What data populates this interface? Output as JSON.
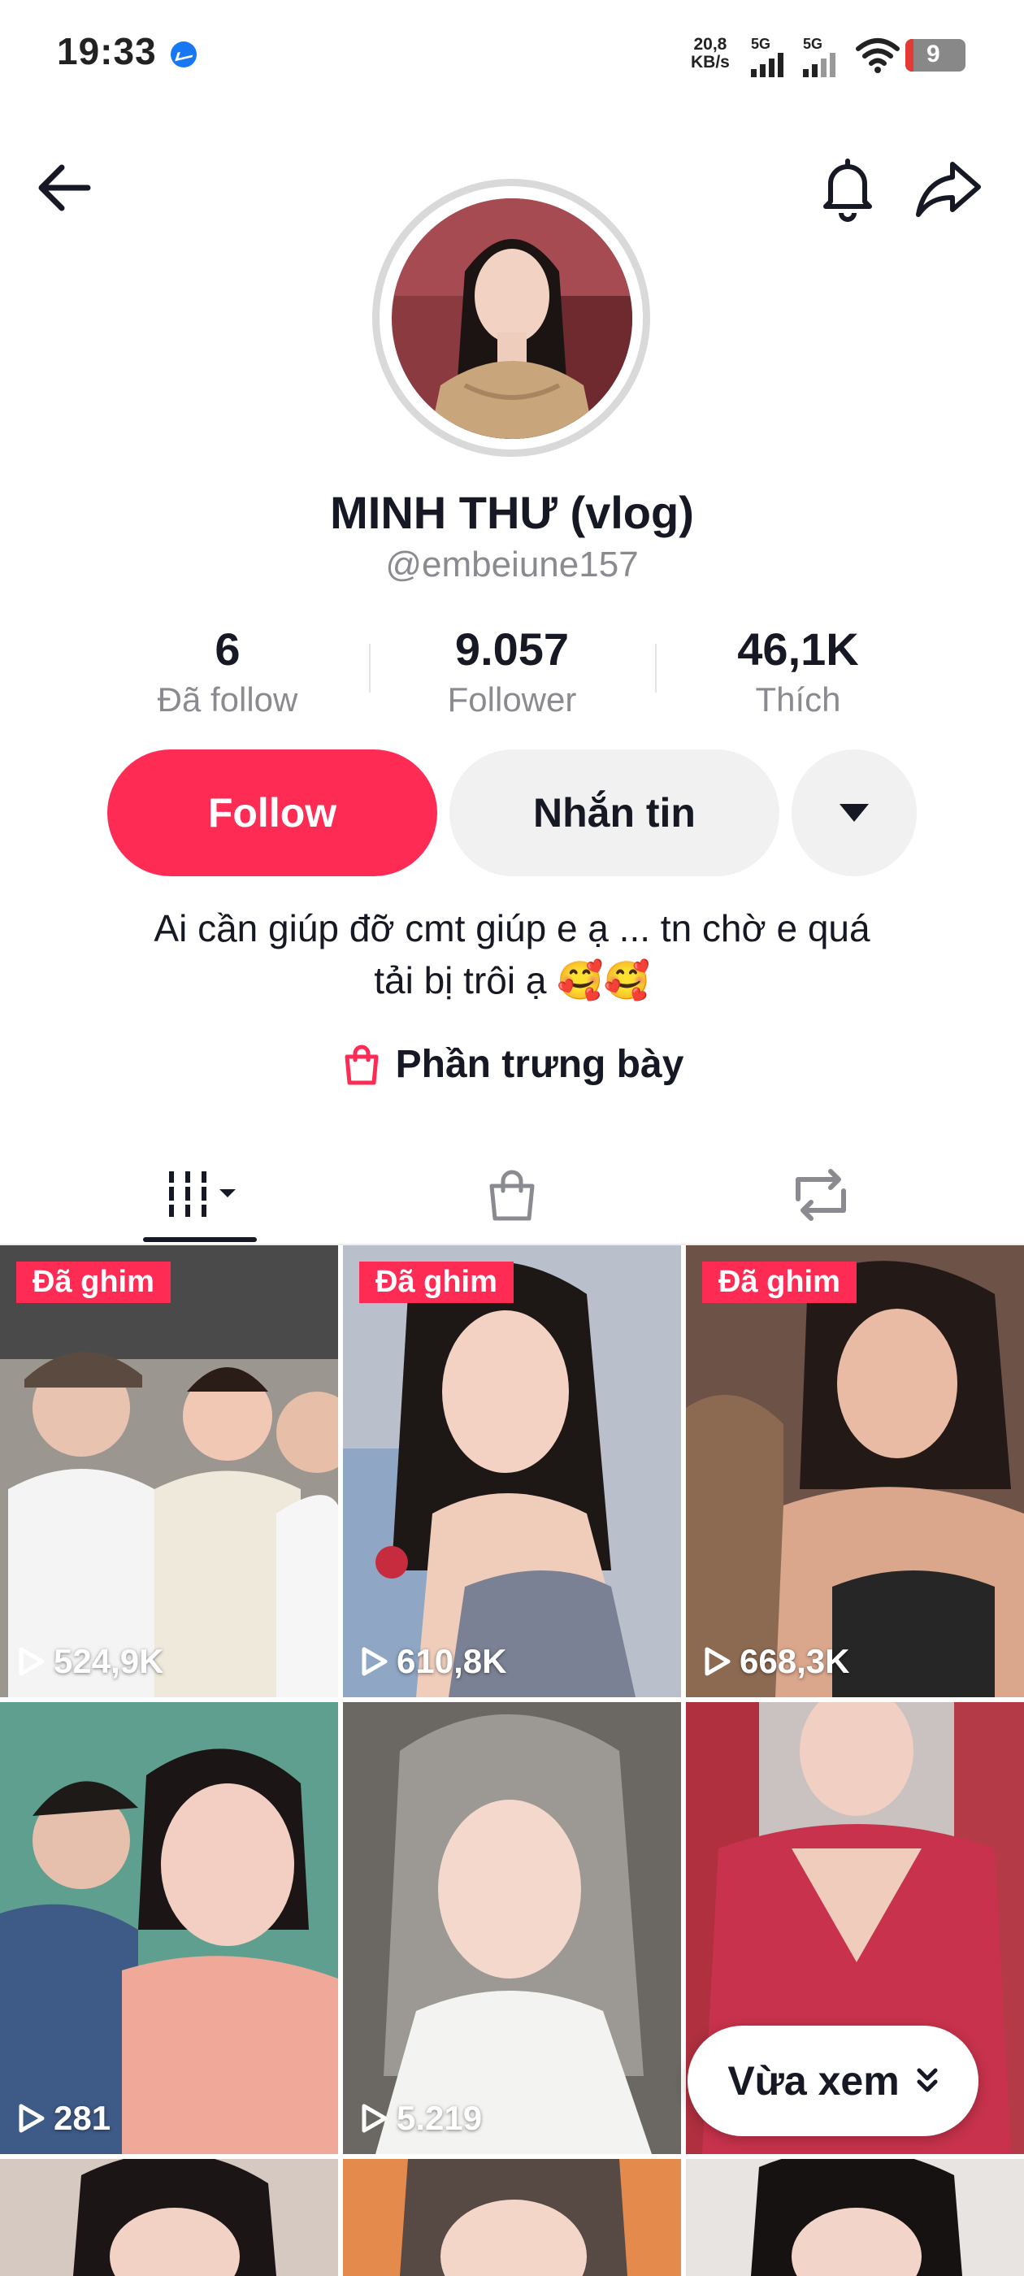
{
  "status_bar": {
    "time": "19:33",
    "net_speed_top": "20,8",
    "net_speed_bottom": "KB/s",
    "sim1": "5G",
    "sim2": "5G",
    "battery": "9"
  },
  "profile": {
    "name": "MINH THƯ (vlog)",
    "handle": "@embeiune157",
    "stats": [
      {
        "value": "6",
        "label": "Đã follow"
      },
      {
        "value": "9.057",
        "label": "Follower"
      },
      {
        "value": "46,1K",
        "label": "Thích"
      }
    ],
    "follow_label": "Follow",
    "message_label": "Nhắn tin",
    "bio_line1": "Ai cần giúp đỡ cmt giúp e ạ ... tn chờ e quá",
    "bio_line2": "tải bị trôi ạ 🥰🥰",
    "showcase_label": "Phần trưng bày"
  },
  "colors": {
    "accent": "#fe2c55",
    "button_grey": "#f1f1f2",
    "text_secondary": "#8a8b91"
  },
  "videos": [
    {
      "pinned": "Đã ghim",
      "views": "524,9K",
      "bg": "#8d8a86"
    },
    {
      "pinned": "Đã ghim",
      "views": "610,8K",
      "bg": "#9aa0ad"
    },
    {
      "pinned": "Đã ghim",
      "views": "668,3K",
      "bg": "#7c6256"
    },
    {
      "views": "281",
      "bg": "#5c8f84"
    },
    {
      "views": "5.219",
      "bg": "#8a8680"
    },
    {
      "views": "",
      "bg": "#b5304a"
    }
  ],
  "recent_button": "Vừa xem"
}
